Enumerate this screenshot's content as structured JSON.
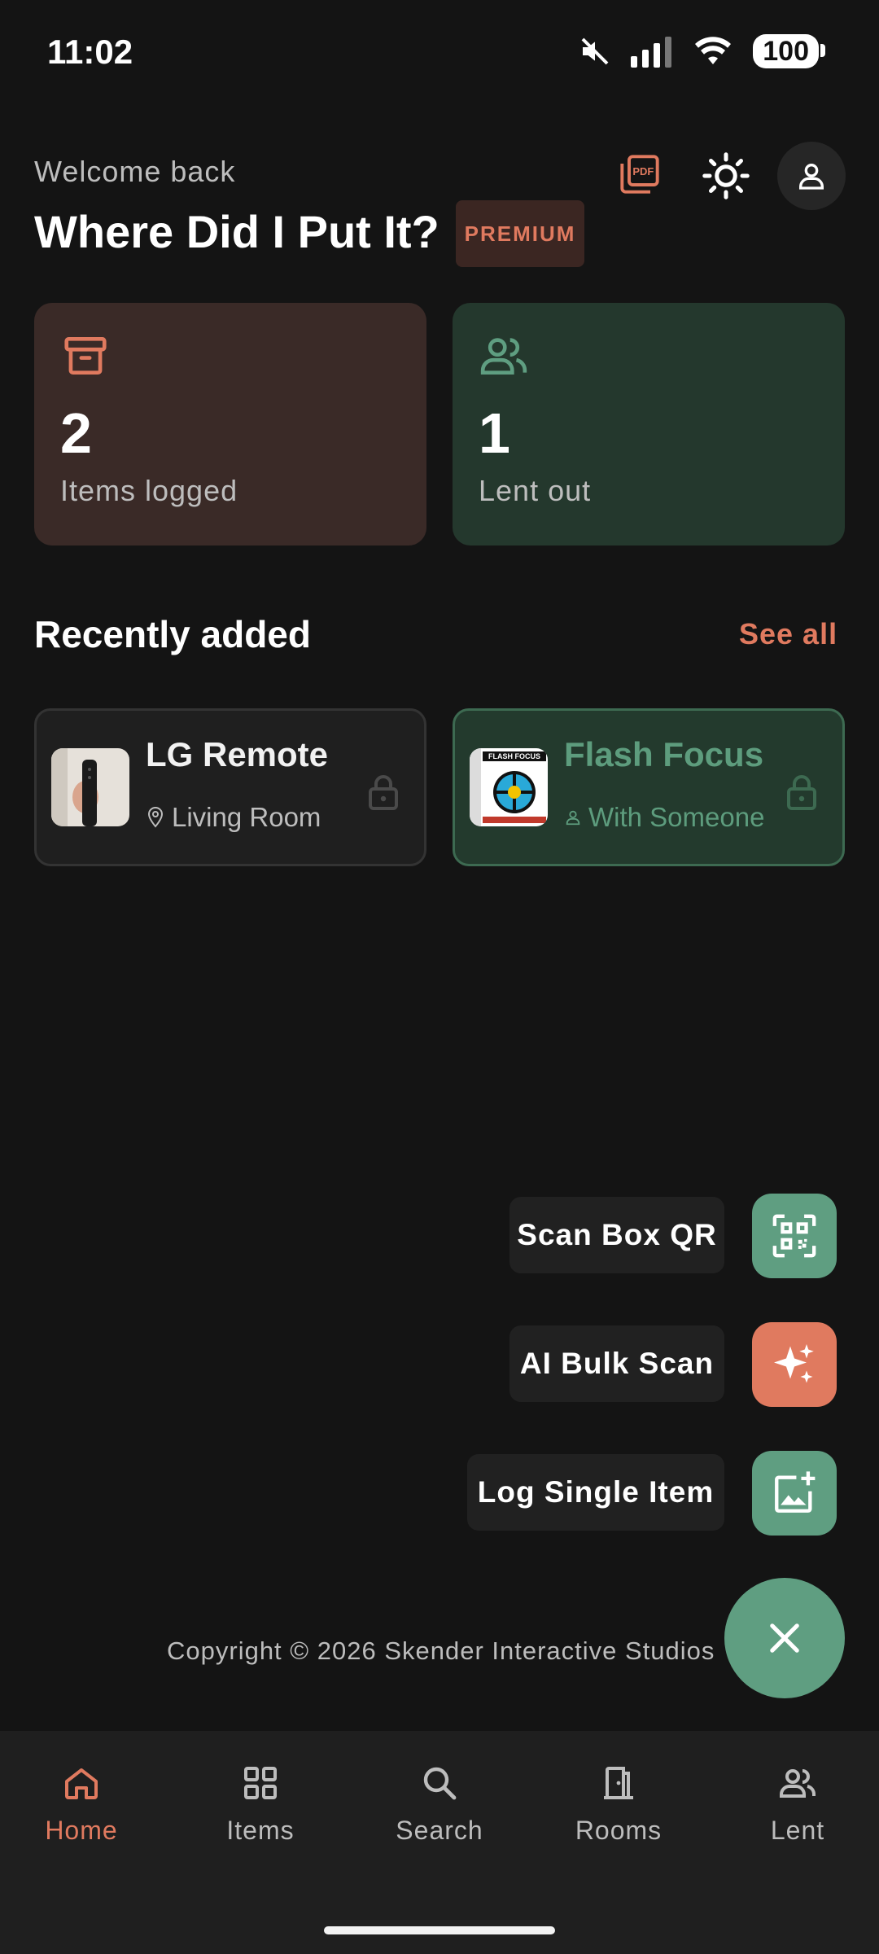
{
  "status_bar": {
    "time": "11:02",
    "battery": "100"
  },
  "header": {
    "welcome": "Welcome back",
    "title": "Where Did I Put It?",
    "badge": "PREMIUM"
  },
  "stats": {
    "items": {
      "count": "2",
      "label": "Items logged"
    },
    "lent": {
      "count": "1",
      "label": "Lent out"
    }
  },
  "recent": {
    "title": "Recently added",
    "see_all": "See all",
    "items": [
      {
        "name": "LG Remote",
        "sub": "Living Room"
      },
      {
        "name": "Flash Focus",
        "sub": "With Someone"
      }
    ]
  },
  "fab_menu": {
    "scan_qr": "Scan Box QR",
    "ai_bulk": "AI Bulk Scan",
    "log_single": "Log Single Item"
  },
  "footer": {
    "copyright": "Copyright © 2026 Skender Interactive Studios"
  },
  "nav": [
    {
      "label": "Home"
    },
    {
      "label": "Items"
    },
    {
      "label": "Search"
    },
    {
      "label": "Rooms"
    },
    {
      "label": "Lent"
    }
  ],
  "colors": {
    "accent_orange": "#e07a5f",
    "accent_green": "#5f9e81",
    "background": "#141414"
  }
}
